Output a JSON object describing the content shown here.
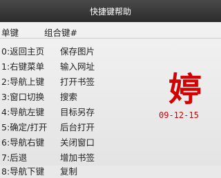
{
  "window": {
    "title": "快捷键帮助"
  },
  "header": {
    "col1": "单键",
    "col2": "组合键#"
  },
  "rows": [
    {
      "key": "0:返回主页",
      "action": "保存图片"
    },
    {
      "key": "1:右键菜单",
      "action": "输入网址"
    },
    {
      "key": "2:导航上键",
      "action": "打开书签"
    },
    {
      "key": "3:窗口切换",
      "action": "搜索"
    },
    {
      "key": "4:导航左键",
      "action": "目标另存"
    },
    {
      "key": "5:确定/打开",
      "action": "后台打开"
    },
    {
      "key": "6:导航右键",
      "action": "关闭窗口"
    },
    {
      "key": "7:后退",
      "action": "增加书签"
    },
    {
      "key": "8:导航下键",
      "action": "复制"
    }
  ],
  "stamp": {
    "glyph": "婷",
    "date": "09-12-15"
  },
  "colors": {
    "accent": "#d40000",
    "titlebar": "#2b2b2b"
  }
}
